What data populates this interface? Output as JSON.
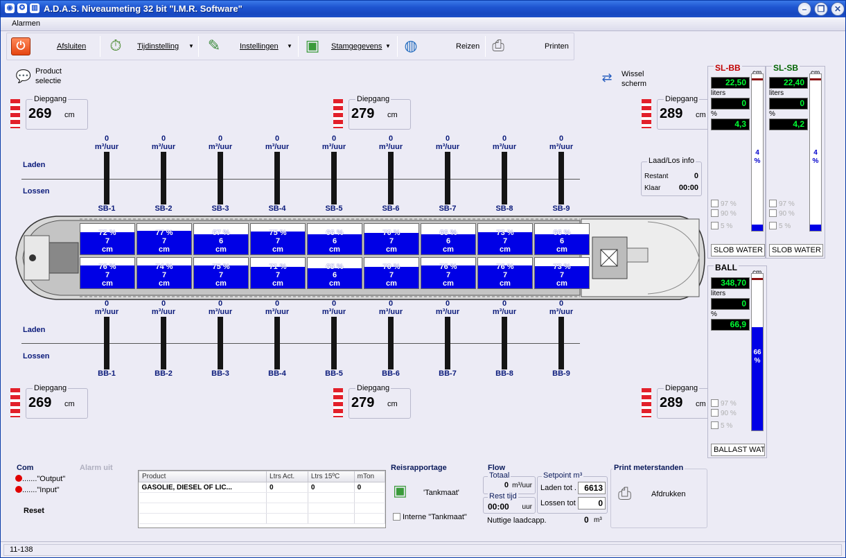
{
  "window": {
    "title": "A.D.A.S. Niveaumeting 32 bit \"I.M.R. Software\""
  },
  "menu": {
    "alarmen": "Alarmen"
  },
  "toolbar": {
    "afsluiten": "Afsluiten",
    "tijdinstelling": "Tijdinstelling",
    "instellingen": "Instellingen",
    "stamgegevens": "Stamgegevens",
    "reizen": "Reizen",
    "printen": "Printen"
  },
  "product_selectie": {
    "line1": "Product",
    "line2": "selectie"
  },
  "wissel_scherm": {
    "line1": "Wissel",
    "line2": "scherm"
  },
  "diepgang": {
    "caption": "Diepgang",
    "unit": "cm",
    "top": [
      "269",
      "279",
      "289"
    ],
    "bottom": [
      "269",
      "279",
      "289"
    ]
  },
  "labels": {
    "laden": "Laden",
    "lossen": "Lossen",
    "flow_unit": "m³/uur"
  },
  "sb_meters": [
    {
      "name": "SB-1",
      "flow": "0"
    },
    {
      "name": "SB-2",
      "flow": "0"
    },
    {
      "name": "SB-3",
      "flow": "0"
    },
    {
      "name": "SB-4",
      "flow": "0"
    },
    {
      "name": "SB-5",
      "flow": "0"
    },
    {
      "name": "SB-6",
      "flow": "0"
    },
    {
      "name": "SB-7",
      "flow": "0"
    },
    {
      "name": "SB-8",
      "flow": "0"
    },
    {
      "name": "SB-9",
      "flow": "0"
    }
  ],
  "bb_meters": [
    {
      "name": "BB-1",
      "flow": "0"
    },
    {
      "name": "BB-2",
      "flow": "0"
    },
    {
      "name": "BB-3",
      "flow": "0"
    },
    {
      "name": "BB-4",
      "flow": "0"
    },
    {
      "name": "BB-5",
      "flow": "0"
    },
    {
      "name": "BB-6",
      "flow": "0"
    },
    {
      "name": "BB-7",
      "flow": "0"
    },
    {
      "name": "BB-8",
      "flow": "0"
    },
    {
      "name": "BB-9",
      "flow": "0"
    }
  ],
  "tanks_sb": [
    {
      "pct": 72,
      "cm": "7"
    },
    {
      "pct": 77,
      "cm": "7"
    },
    {
      "pct": 67,
      "cm": "6"
    },
    {
      "pct": 75,
      "cm": "7"
    },
    {
      "pct": 66,
      "cm": "6"
    },
    {
      "pct": 70,
      "cm": "7"
    },
    {
      "pct": 66,
      "cm": "6"
    },
    {
      "pct": 73,
      "cm": "7"
    },
    {
      "pct": 66,
      "cm": "6"
    }
  ],
  "tanks_bb": [
    {
      "pct": 76,
      "cm": "7"
    },
    {
      "pct": 74,
      "cm": "7"
    },
    {
      "pct": 75,
      "cm": "7"
    },
    {
      "pct": 71,
      "cm": "7"
    },
    {
      "pct": 65,
      "cm": "6"
    },
    {
      "pct": 70,
      "cm": "7"
    },
    {
      "pct": 76,
      "cm": "7"
    },
    {
      "pct": 76,
      "cm": "7"
    },
    {
      "pct": 73,
      "cm": "7"
    }
  ],
  "tank_units": {
    "pct": "%",
    "cm": "cm"
  },
  "laadlos": {
    "title": "Laad/Los info",
    "restant_label": "Restant",
    "restant": "0",
    "klaar_label": "Klaar",
    "klaar": "00:00"
  },
  "slbb": {
    "title": "SL-BB",
    "cm_label": "cm",
    "cm": "22,50",
    "liters_label": "liters",
    "liters": "0",
    "pct_label": "%",
    "pct": "4,3",
    "bar_pct": 4,
    "bar_text1": "4",
    "bar_text2": "%",
    "chk97": "97 %",
    "chk90": "90 %",
    "chk5": "5 %",
    "product": "SLOB WATER"
  },
  "slsb": {
    "title": "SL-SB",
    "cm_label": "cm",
    "cm": "22,40",
    "liters_label": "liters",
    "liters": "0",
    "pct_label": "%",
    "pct": "4,2",
    "bar_pct": 4,
    "bar_text1": "4",
    "bar_text2": "%",
    "chk97": "97 %",
    "chk90": "90 %",
    "chk5": "5 %",
    "product": "SLOB WATER"
  },
  "ball": {
    "title": "BALL",
    "cm_label": "cm",
    "cm": "348,70",
    "liters_label": "liters",
    "liters": "0",
    "pct_label": "%",
    "pct": "66,9",
    "bar_pct": 66,
    "bar_text1": "66",
    "bar_text2": "%",
    "chk97": "97 %",
    "chk90": "90 %",
    "chk5": "5 %",
    "product": "BALLAST WATER"
  },
  "com": {
    "title": "Com",
    "output": ".......\"Output\"",
    "input": ".......\"Input\"",
    "reset": "Reset"
  },
  "alarm_uit": "Alarm uit",
  "product_table": {
    "headers": [
      "Product",
      "Ltrs Act.",
      "Ltrs 15ºC",
      "mTon"
    ],
    "rows": [
      [
        "GASOLIE, DIESEL OF LIC...",
        "0",
        "0",
        "0"
      ]
    ]
  },
  "reisrapportage": {
    "title": "Reisrapportage",
    "tankmaat": "'Tankmaat'",
    "interne": "Interne \"Tankmaat\""
  },
  "flow": {
    "title": "Flow",
    "totaal_label": "Totaal",
    "totaal": "0",
    "totaal_unit": "m³/uur",
    "resttijd_label": "Rest tijd",
    "resttijd": "00:00",
    "resttijd_unit": "uur",
    "setpoint_label": "Setpoint m³",
    "laden_tot_label": "Laden tot .",
    "laden_tot": "6613",
    "lossen_tot_label": "Lossen tot",
    "lossen_tot": "0",
    "nuttige_label": "Nuttige laadcapp.",
    "nuttige": "0",
    "nuttige_unit": "m³"
  },
  "print_meterstanden": {
    "title": "Print meterstanden",
    "afdrukken": "Afdrukken"
  },
  "status": {
    "text": "11-138"
  },
  "colors": {
    "tank_fill": "#0000e6",
    "lcd_text": "#00ff33",
    "diep_stripe": "#e2202a",
    "title_bar": "#1e54d0"
  }
}
